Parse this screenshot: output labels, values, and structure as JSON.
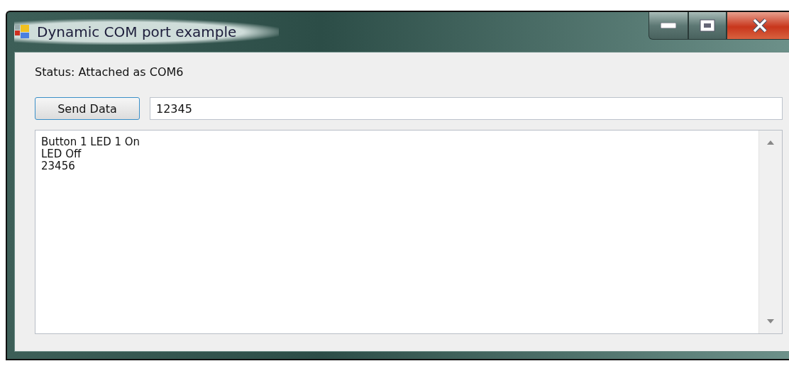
{
  "window": {
    "title": "Dynamic COM port example"
  },
  "status": "Status: Attached as COM6",
  "send_button": "Send Data",
  "data_field": {
    "value": "12345"
  },
  "output_lines": [
    "Button 1 LED 1 On",
    "LED Off",
    "23456"
  ]
}
